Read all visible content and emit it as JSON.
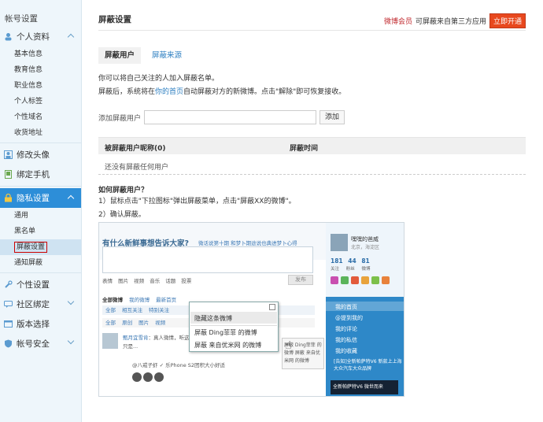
{
  "sidebar": {
    "title": "帐号设置",
    "groups": [
      {
        "label": "个人资料",
        "icon": "user-icon"
      },
      {
        "label": "修改头像",
        "icon": "portrait-icon"
      },
      {
        "label": "绑定手机",
        "icon": "phone-icon"
      },
      {
        "label": "隐私设置",
        "icon": "lock-icon"
      },
      {
        "label": "个性设置",
        "icon": "wrench-icon"
      },
      {
        "label": "社区绑定",
        "icon": "chat-icon"
      },
      {
        "label": "版本选择",
        "icon": "window-icon"
      },
      {
        "label": "帐号安全",
        "icon": "shield-icon"
      }
    ],
    "profile_items": [
      "基本信息",
      "教育信息",
      "职业信息",
      "个人标签",
      "个性域名",
      "收货地址"
    ],
    "privacy_items": [
      "通用",
      "黑名单",
      "屏蔽设置",
      "通知屏蔽"
    ]
  },
  "header": {
    "title": "屏蔽设置",
    "vip_link": "微博会员",
    "vip_text": "可屏蔽来自第三方应用",
    "open_button": "立即开通"
  },
  "tabs": [
    "屏蔽用户",
    "屏蔽来源"
  ],
  "desc": {
    "line1": "你可以将自己关注的人加入屏蔽名单。",
    "line2_a": "屏蔽后，系统将在",
    "line2_link": "你的首页",
    "line2_b": "自动屏蔽对方的新微博。点击\"解除\"即可恢复接收。"
  },
  "add": {
    "label": "添加屏蔽用户",
    "value": "",
    "button": "添加"
  },
  "table": {
    "col1": "被屏蔽用户昵称(0)",
    "col2": "屏蔽时间",
    "empty": "还没有屏蔽任何用户"
  },
  "howto": {
    "title": "如何屏蔽用户？",
    "step1": "1）鼠标点击\"下拉图标\"弹出屏蔽菜单，点击\"屏蔽XX的微博\"。",
    "step2": "2）确认屏蔽。"
  },
  "demo": {
    "question": "有什么新鲜事想告诉大家?",
    "question_hint": "微话说第十期 和梦卜期途说也典进梦卜心得",
    "toolbar": "表情 图片 视频 音乐 话题 投票",
    "post_button": "发布",
    "feed_tabs_bold": "全部微博",
    "feed_tabs": "我的微博 最新首页",
    "bar1": "全部 相互关注 特别关注",
    "bar2": "全部 原创 图片 视频",
    "post_name": "甄月宜雪肯",
    "post_text": "：真人微情，听这此Sir好啊，只是...",
    "post2": "@八戒子虾 ✓ 乐Phone S2团积大小好适",
    "popup_items": [
      "隐藏这条微博",
      "屏蔽 Ding菲菲 的微博",
      "屏蔽 来自优米网 的微博"
    ],
    "sub_popup": "屏蔽 Ding菲菲 的微博 屏蔽 来自优米网 的微博",
    "rc_name": "嘿嘿的爸威",
    "rc_sub": "北京，海淀区",
    "rc_stats": "181 44 81",
    "rc_stats_labels": "关注 粉丝 微博",
    "rc_links": [
      "我的首页",
      "@提到我的",
      "我的评论",
      "我的私信",
      "我的收藏"
    ],
    "rc_info": "[告知]全新帕萨特V6 新款上上海大众汽车大众品牌",
    "rc_ad": "全新帕萨特V6 微世而来"
  }
}
